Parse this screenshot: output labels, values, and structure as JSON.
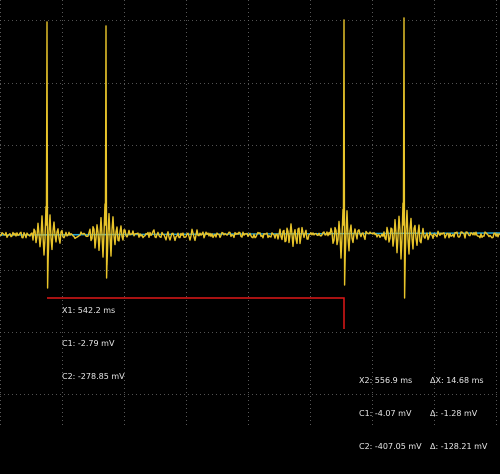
{
  "colors": {
    "background": "#000000",
    "grid": "#6e6e6e",
    "channel1_trace": "#e8c42a",
    "channel2_trace": "#22a6d8",
    "cursor": "#e01818",
    "readout_text": "#e6e6e6"
  },
  "cursor1": {
    "x_label": "X1: 542.2 ms",
    "c1_label": "C1: -2.79 mV",
    "c2_label": "C2: -278.85 mV"
  },
  "cursor2": {
    "x_label": "X2: 556.9 ms",
    "c1_label": "C1: -4.07 mV",
    "c2_label": "C2: -407.05 mV"
  },
  "delta": {
    "dx_label": "ΔX: 14.68 ms",
    "d1_label": "Δ: -1.28 mV",
    "d2_label": "Δ: -128.21 mV"
  }
}
